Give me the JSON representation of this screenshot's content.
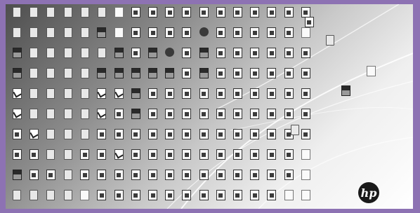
{
  "desktop": {
    "brand_logo_text": "hp",
    "rows": [
      [
        {
          "k": "folder",
          "t": ""
        },
        {
          "k": "folder",
          "t": ""
        },
        {
          "k": "folder",
          "t": ""
        },
        {
          "k": "folder",
          "t": ""
        },
        {
          "k": "folder",
          "t": ""
        },
        {
          "k": "folder",
          "t": ""
        },
        {
          "k": "blank",
          "t": ""
        },
        {
          "k": "doc",
          "t": ""
        },
        {
          "k": "doc",
          "t": ""
        },
        {
          "k": "doc",
          "t": ""
        },
        {
          "k": "doc",
          "t": ""
        },
        {
          "k": "doc",
          "t": ""
        },
        {
          "k": "doc",
          "t": ""
        },
        {
          "k": "doc",
          "t": ""
        },
        {
          "k": "doc",
          "t": ""
        },
        {
          "k": "doc",
          "t": ""
        },
        {
          "k": "doc",
          "t": ""
        },
        {
          "k": "doc",
          "t": ""
        }
      ],
      [
        {
          "k": "folder",
          "t": ""
        },
        {
          "k": "folder",
          "t": ""
        },
        {
          "k": "folder",
          "t": ""
        },
        {
          "k": "folder",
          "t": ""
        },
        {
          "k": "folder",
          "t": ""
        },
        {
          "k": "img",
          "t": ""
        },
        {
          "k": "blank",
          "t": ""
        },
        {
          "k": "doc",
          "t": ""
        },
        {
          "k": "doc",
          "t": ""
        },
        {
          "k": "doc",
          "t": ""
        },
        {
          "k": "doc",
          "t": ""
        },
        {
          "k": "app",
          "t": ""
        },
        {
          "k": "doc",
          "t": ""
        },
        {
          "k": "doc",
          "t": ""
        },
        {
          "k": "doc",
          "t": ""
        },
        {
          "k": "doc",
          "t": ""
        },
        {
          "k": "doc",
          "t": ""
        },
        {
          "k": "blank",
          "t": ""
        }
      ],
      [
        {
          "k": "img",
          "t": ""
        },
        {
          "k": "folder",
          "t": ""
        },
        {
          "k": "folder",
          "t": ""
        },
        {
          "k": "folder",
          "t": ""
        },
        {
          "k": "folder",
          "t": ""
        },
        {
          "k": "folder",
          "t": ""
        },
        {
          "k": "img",
          "t": ""
        },
        {
          "k": "doc",
          "t": ""
        },
        {
          "k": "img",
          "t": ""
        },
        {
          "k": "app",
          "t": ""
        },
        {
          "k": "doc",
          "t": ""
        },
        {
          "k": "img",
          "t": ""
        },
        {
          "k": "doc",
          "t": ""
        },
        {
          "k": "doc",
          "t": ""
        },
        {
          "k": "doc",
          "t": ""
        },
        {
          "k": "doc",
          "t": ""
        },
        {
          "k": "doc",
          "t": ""
        },
        {
          "k": "doc",
          "t": ""
        }
      ],
      [
        {
          "k": "img",
          "t": ""
        },
        {
          "k": "folder",
          "t": ""
        },
        {
          "k": "folder",
          "t": ""
        },
        {
          "k": "folder",
          "t": ""
        },
        {
          "k": "folder",
          "t": ""
        },
        {
          "k": "img",
          "t": ""
        },
        {
          "k": "img",
          "t": ""
        },
        {
          "k": "img",
          "t": ""
        },
        {
          "k": "img",
          "t": ""
        },
        {
          "k": "img",
          "t": ""
        },
        {
          "k": "doc",
          "t": ""
        },
        {
          "k": "img",
          "t": ""
        },
        {
          "k": "doc",
          "t": ""
        },
        {
          "k": "doc",
          "t": ""
        },
        {
          "k": "doc",
          "t": ""
        },
        {
          "k": "doc",
          "t": ""
        },
        {
          "k": "doc",
          "t": ""
        },
        {
          "k": "doc",
          "t": ""
        }
      ],
      [
        {
          "k": "pdf",
          "t": ""
        },
        {
          "k": "folder",
          "t": ""
        },
        {
          "k": "folder",
          "t": ""
        },
        {
          "k": "folder",
          "t": ""
        },
        {
          "k": "folder",
          "t": ""
        },
        {
          "k": "pdf",
          "t": ""
        },
        {
          "k": "pdf",
          "t": ""
        },
        {
          "k": "img",
          "t": ""
        },
        {
          "k": "doc",
          "t": ""
        },
        {
          "k": "doc",
          "t": ""
        },
        {
          "k": "doc",
          "t": ""
        },
        {
          "k": "doc",
          "t": ""
        },
        {
          "k": "doc",
          "t": ""
        },
        {
          "k": "doc",
          "t": ""
        },
        {
          "k": "doc",
          "t": ""
        },
        {
          "k": "doc",
          "t": ""
        },
        {
          "k": "doc",
          "t": ""
        },
        {
          "k": "doc",
          "t": ""
        }
      ],
      [
        {
          "k": "pdf",
          "t": ""
        },
        {
          "k": "folder",
          "t": ""
        },
        {
          "k": "folder",
          "t": ""
        },
        {
          "k": "folder",
          "t": ""
        },
        {
          "k": "folder",
          "t": ""
        },
        {
          "k": "pdf",
          "t": ""
        },
        {
          "k": "doc",
          "t": ""
        },
        {
          "k": "img",
          "t": ""
        },
        {
          "k": "doc",
          "t": ""
        },
        {
          "k": "doc",
          "t": ""
        },
        {
          "k": "doc",
          "t": ""
        },
        {
          "k": "doc",
          "t": ""
        },
        {
          "k": "doc",
          "t": ""
        },
        {
          "k": "doc",
          "t": ""
        },
        {
          "k": "doc",
          "t": ""
        },
        {
          "k": "doc",
          "t": ""
        },
        {
          "k": "doc",
          "t": ""
        },
        {
          "k": "doc",
          "t": ""
        }
      ],
      [
        {
          "k": "doc",
          "t": ""
        },
        {
          "k": "pdf",
          "t": ""
        },
        {
          "k": "folder",
          "t": ""
        },
        {
          "k": "folder",
          "t": ""
        },
        {
          "k": "folder",
          "t": ""
        },
        {
          "k": "doc",
          "t": ""
        },
        {
          "k": "doc",
          "t": ""
        },
        {
          "k": "doc",
          "t": ""
        },
        {
          "k": "doc",
          "t": ""
        },
        {
          "k": "doc",
          "t": ""
        },
        {
          "k": "doc",
          "t": ""
        },
        {
          "k": "doc",
          "t": ""
        },
        {
          "k": "doc",
          "t": ""
        },
        {
          "k": "doc",
          "t": ""
        },
        {
          "k": "doc",
          "t": ""
        },
        {
          "k": "doc",
          "t": ""
        },
        {
          "k": "doc",
          "t": ""
        },
        {
          "k": "doc",
          "t": ""
        }
      ],
      [
        {
          "k": "doc",
          "t": ""
        },
        {
          "k": "doc",
          "t": ""
        },
        {
          "k": "folder",
          "t": ""
        },
        {
          "k": "folder",
          "t": ""
        },
        {
          "k": "doc",
          "t": ""
        },
        {
          "k": "doc",
          "t": ""
        },
        {
          "k": "pdf",
          "t": ""
        },
        {
          "k": "doc",
          "t": ""
        },
        {
          "k": "doc",
          "t": ""
        },
        {
          "k": "doc",
          "t": ""
        },
        {
          "k": "doc",
          "t": ""
        },
        {
          "k": "doc",
          "t": ""
        },
        {
          "k": "doc",
          "t": ""
        },
        {
          "k": "doc",
          "t": ""
        },
        {
          "k": "doc",
          "t": ""
        },
        {
          "k": "doc",
          "t": ""
        },
        {
          "k": "doc",
          "t": ""
        },
        {
          "k": "blank",
          "t": ""
        }
      ],
      [
        {
          "k": "img",
          "t": ""
        },
        {
          "k": "doc",
          "t": ""
        },
        {
          "k": "doc",
          "t": ""
        },
        {
          "k": "folder",
          "t": ""
        },
        {
          "k": "doc",
          "t": ""
        },
        {
          "k": "doc",
          "t": ""
        },
        {
          "k": "doc",
          "t": ""
        },
        {
          "k": "doc",
          "t": ""
        },
        {
          "k": "doc",
          "t": ""
        },
        {
          "k": "doc",
          "t": ""
        },
        {
          "k": "doc",
          "t": ""
        },
        {
          "k": "doc",
          "t": ""
        },
        {
          "k": "doc",
          "t": ""
        },
        {
          "k": "doc",
          "t": ""
        },
        {
          "k": "doc",
          "t": ""
        },
        {
          "k": "doc",
          "t": ""
        },
        {
          "k": "doc",
          "t": ""
        },
        {
          "k": "blank",
          "t": ""
        }
      ],
      [
        {
          "k": "folder",
          "t": ""
        },
        {
          "k": "folder",
          "t": ""
        },
        {
          "k": "folder",
          "t": ""
        },
        {
          "k": "folder",
          "t": ""
        },
        {
          "k": "blank",
          "t": ""
        },
        {
          "k": "doc",
          "t": ""
        },
        {
          "k": "doc",
          "t": ""
        },
        {
          "k": "doc",
          "t": ""
        },
        {
          "k": "doc",
          "t": ""
        },
        {
          "k": "doc",
          "t": ""
        },
        {
          "k": "doc",
          "t": ""
        },
        {
          "k": "doc",
          "t": ""
        },
        {
          "k": "doc",
          "t": ""
        },
        {
          "k": "doc",
          "t": ""
        },
        {
          "k": "doc",
          "t": ""
        },
        {
          "k": "doc",
          "t": ""
        },
        {
          "k": "blank",
          "t": ""
        },
        {
          "k": "blank",
          "t": ""
        }
      ]
    ],
    "side_icons": [
      {
        "k": "doc",
        "t": ""
      },
      {
        "k": "folder",
        "t": ""
      },
      {
        "k": "blank",
        "t": ""
      },
      {
        "k": "img",
        "t": ""
      },
      {
        "k": "folder",
        "t": ""
      }
    ]
  }
}
